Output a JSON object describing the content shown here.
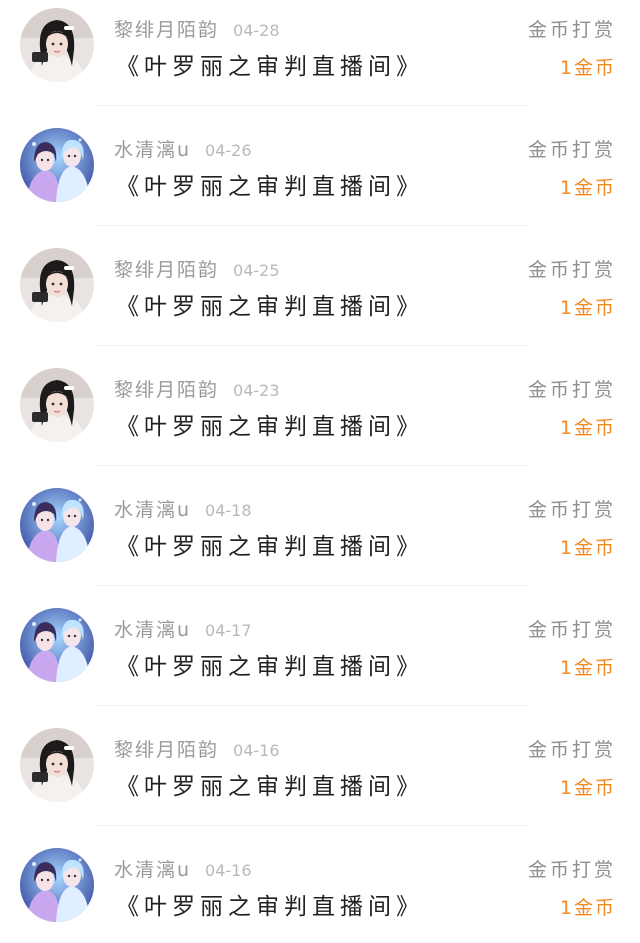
{
  "reward_list": {
    "items": [
      {
        "user": "黎绯月陌韵",
        "date": "04-28",
        "title": "《叶罗丽之审判直播间》",
        "action": "金币打赏",
        "amount": "1金币",
        "avatar": "girl-avatar-icon"
      },
      {
        "user": "水清漓u",
        "date": "04-26",
        "title": "《叶罗丽之审判直播间》",
        "action": "金币打赏",
        "amount": "1金币",
        "avatar": "anime-couple-avatar-icon"
      },
      {
        "user": "黎绯月陌韵",
        "date": "04-25",
        "title": "《叶罗丽之审判直播间》",
        "action": "金币打赏",
        "amount": "1金币",
        "avatar": "girl-avatar-icon"
      },
      {
        "user": "黎绯月陌韵",
        "date": "04-23",
        "title": "《叶罗丽之审判直播间》",
        "action": "金币打赏",
        "amount": "1金币",
        "avatar": "girl-avatar-icon"
      },
      {
        "user": "水清漓u",
        "date": "04-18",
        "title": "《叶罗丽之审判直播间》",
        "action": "金币打赏",
        "amount": "1金币",
        "avatar": "anime-couple-avatar-icon"
      },
      {
        "user": "水清漓u",
        "date": "04-17",
        "title": "《叶罗丽之审判直播间》",
        "action": "金币打赏",
        "amount": "1金币",
        "avatar": "anime-couple-avatar-icon"
      },
      {
        "user": "黎绯月陌韵",
        "date": "04-16",
        "title": "《叶罗丽之审判直播间》",
        "action": "金币打赏",
        "amount": "1金币",
        "avatar": "girl-avatar-icon"
      },
      {
        "user": "水清漓u",
        "date": "04-16",
        "title": "《叶罗丽之审判直播间》",
        "action": "金币打赏",
        "amount": "1金币",
        "avatar": "anime-couple-avatar-icon"
      }
    ]
  },
  "colors": {
    "amount": "#f08a24",
    "meta_text": "#9a9a9a",
    "title_text": "#222222",
    "divider": "#f1f1f1"
  }
}
